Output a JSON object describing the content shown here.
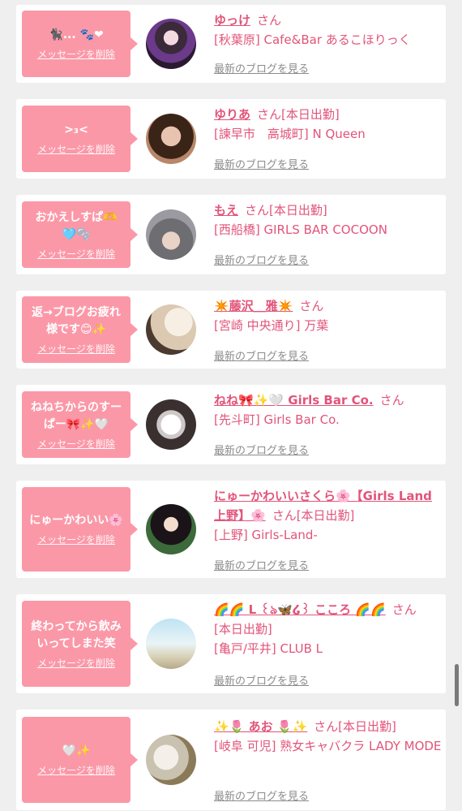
{
  "cards": [
    {
      "bubble": "🐈‍⬛... 🐾❤",
      "delete_label": "メッセージを削除",
      "name": "ゆっけ",
      "san": "さん",
      "status": "",
      "shop": "[秋葉原] Cafe&Bar あるこほりっく",
      "blog_label": "最新のブログを見る"
    },
    {
      "bubble": ">₃<",
      "delete_label": "メッセージを削除",
      "name": "ゆりあ",
      "san": "さん",
      "status": "[本日出勤]",
      "shop": "[諫早市　高城町] N Queen",
      "blog_label": "最新のブログを見る"
    },
    {
      "bubble": "おかえしすぱ🫶 🩵🫧",
      "delete_label": "メッセージを削除",
      "name": "もえ",
      "san": "さん",
      "status": "[本日出勤]",
      "shop": "[西船橋] GIRLS BAR COCOON",
      "blog_label": "最新のブログを見る"
    },
    {
      "bubble": "返→ブログお疲れ様です😊✨",
      "delete_label": "メッセージを削除",
      "name": "✴️藤沢＿雅✴️",
      "san": "さん",
      "status": "",
      "shop": "[宮崎 中央通り] 万葉",
      "blog_label": "最新のブログを見る"
    },
    {
      "bubble": "ねねちからのすーぱー🎀✨🤍",
      "delete_label": "メッセージを削除",
      "name": "ねね🎀✨🤍 Girls Bar Co.",
      "san": "さん",
      "status": "",
      "shop": "[先斗町] Girls Bar Co.",
      "blog_label": "最新のブログを見る"
    },
    {
      "bubble": "にゅーかわいい🌸",
      "delete_label": "メッセージを削除",
      "name": "にゅーかわいいさくら🌸【Girls Land上野】🌸",
      "san": "さん",
      "status": "[本日出勤]",
      "shop": "[上野] Girls-Land-",
      "blog_label": "最新のブログを見る"
    },
    {
      "bubble": "終わってから飲みいってしまた笑",
      "delete_label": "メッセージを削除",
      "name": "🌈🌈 L ꒰ঌ🦋໒꒱ こころ 🌈🌈",
      "san": "さん",
      "status": "[本日出勤]",
      "shop": "[亀戸/平井] CLUB L",
      "blog_label": "最新のブログを見る"
    },
    {
      "bubble": "🤍✨",
      "delete_label": "メッセージを削除",
      "name": "✨🌷 あお 🌷✨",
      "san": "さん",
      "status": "[本日出勤]",
      "shop": "[岐阜 可児] 熟女キャバクラ LADY MODE",
      "blog_label": "最新のブログを見る"
    }
  ],
  "colors": {
    "bubble": "#fb98a8",
    "name": "#e2547a",
    "link": "#8c8c8c",
    "background": "#efefef"
  }
}
